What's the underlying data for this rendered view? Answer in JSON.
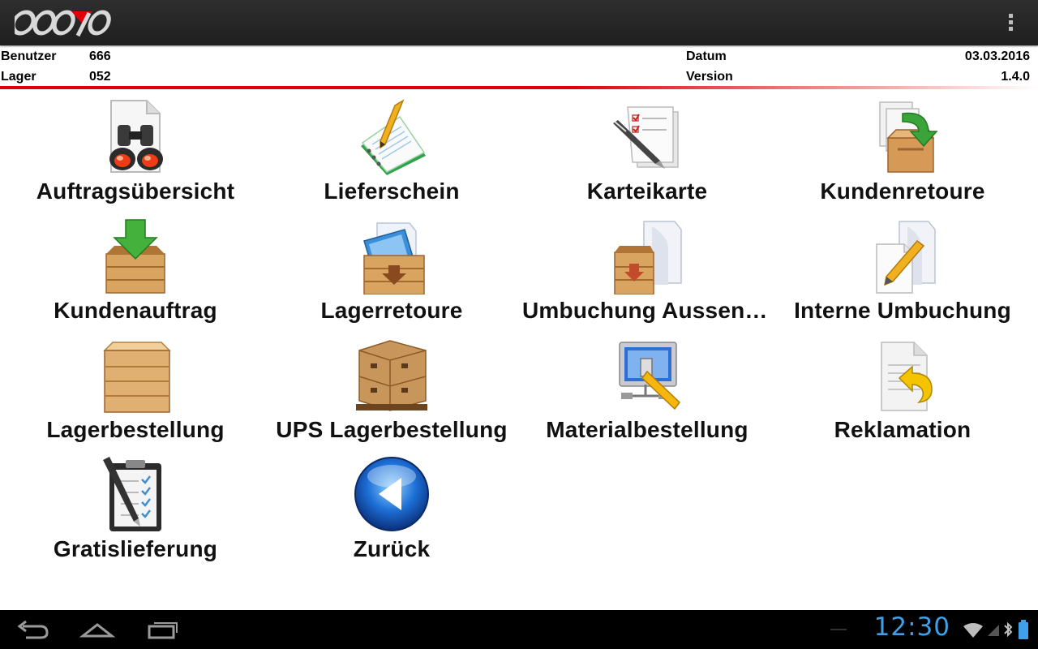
{
  "header": {
    "logo_alt": "cosyo",
    "menu_icon": "overflow-menu-icon"
  },
  "info": {
    "user_label": "Benutzer",
    "user_value": "666",
    "store_label": "Lager",
    "store_value": "052",
    "date_label": "Datum",
    "date_value": "03.03.2016",
    "version_label": "Version",
    "version_value": "1.4.0",
    "accent_color": "#e0000b"
  },
  "menu": {
    "items": [
      {
        "label": "Auftragsübersicht",
        "icon": "binoculars-document-icon"
      },
      {
        "label": "Lieferschein",
        "icon": "notebook-pencil-icon"
      },
      {
        "label": "Karteikarte",
        "icon": "checklist-pen-icon"
      },
      {
        "label": "Kundenretoure",
        "icon": "box-return-arrow-icon"
      },
      {
        "label": "Kundenauftrag",
        "icon": "box-down-arrow-icon"
      },
      {
        "label": "Lagerretoure",
        "icon": "crate-folder-icon"
      },
      {
        "label": "Umbuchung Aussenl…",
        "icon": "crate-documents-icon"
      },
      {
        "label": "Interne Umbuchung",
        "icon": "documents-pencil-icon"
      },
      {
        "label": "Lagerbestellung",
        "icon": "wooden-crate-icon"
      },
      {
        "label": "UPS Lagerbestellung",
        "icon": "pallet-boxes-icon"
      },
      {
        "label": "Materialbestellung",
        "icon": "monitor-wrench-icon"
      },
      {
        "label": "Reklamation",
        "icon": "document-return-icon"
      },
      {
        "label": "Gratislieferung",
        "icon": "clipboard-checklist-icon"
      },
      {
        "label": "Zurück",
        "icon": "back-arrow-icon"
      }
    ]
  },
  "system_bar": {
    "time": "12:30",
    "clock_color": "#3fa0e8"
  }
}
